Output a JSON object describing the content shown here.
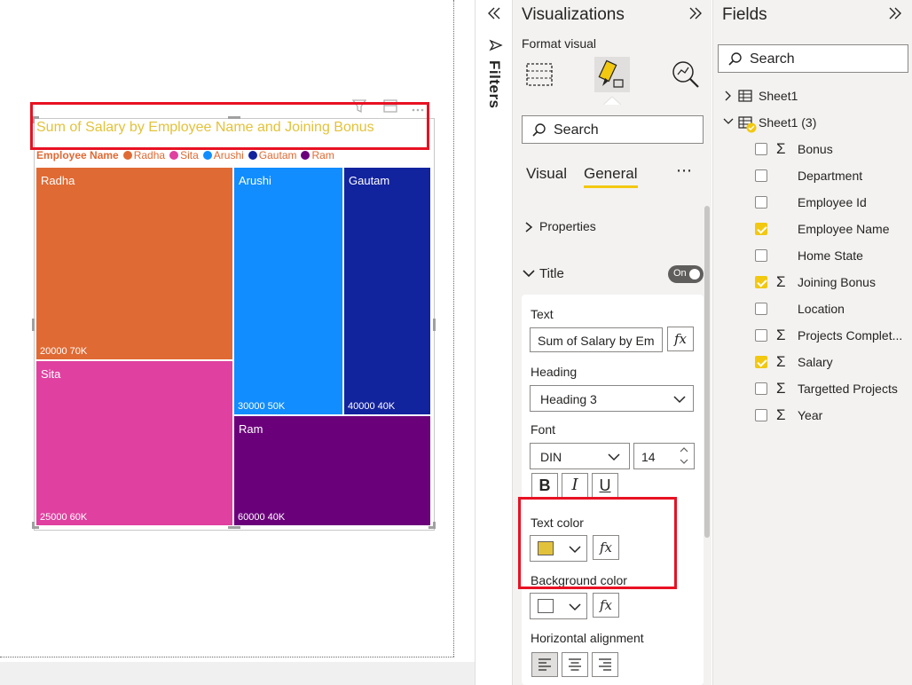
{
  "canvas": {
    "chart": {
      "title": "Sum of Salary by Employee Name and Joining Bonus",
      "legend_title": "Employee Name",
      "legend": [
        {
          "name": "Radha",
          "color": "#e06a34"
        },
        {
          "name": "Sita",
          "color": "#e040a0"
        },
        {
          "name": "Arushi",
          "color": "#118dff"
        },
        {
          "name": "Gautam",
          "color": "#12239e"
        },
        {
          "name": "Ram",
          "color": "#6b007b"
        }
      ],
      "tiles": [
        {
          "name": "Radha",
          "value_label": "20000 70K"
        },
        {
          "name": "Sita",
          "value_label": "25000 60K"
        },
        {
          "name": "Arushi",
          "value_label": "30000 50K"
        },
        {
          "name": "Gautam",
          "value_label": "40000 40K"
        },
        {
          "name": "Ram",
          "value_label": "60000 40K"
        }
      ]
    }
  },
  "chart_data": {
    "type": "treemap",
    "title": "Sum of Salary by Employee Name and Joining Bonus",
    "legend_title": "Employee Name",
    "series": [
      {
        "name": "Radha",
        "joining_bonus": 20000,
        "salary": 70000,
        "label": "20000 70K"
      },
      {
        "name": "Sita",
        "joining_bonus": 25000,
        "salary": 60000,
        "label": "25000 60K"
      },
      {
        "name": "Arushi",
        "joining_bonus": 30000,
        "salary": 50000,
        "label": "30000 50K"
      },
      {
        "name": "Gautam",
        "joining_bonus": 40000,
        "salary": 40000,
        "label": "40000 40K"
      },
      {
        "name": "Ram",
        "joining_bonus": 60000,
        "salary": 40000,
        "label": "60000 40K"
      }
    ]
  },
  "filters": {
    "label": "Filters"
  },
  "viz_pane": {
    "title": "Visualizations",
    "subtitle": "Format visual",
    "search_placeholder": "Search",
    "tabs": [
      "Visual",
      "General"
    ],
    "more": "⋯",
    "properties_label": "Properties",
    "title_section": {
      "label": "Title",
      "toggle": "On",
      "text_label": "Text",
      "text_value": "Sum of Salary by Em",
      "heading_label": "Heading",
      "heading_value": "Heading 3",
      "font_label": "Font",
      "font_value": "DIN",
      "font_size": "14",
      "bold": "B",
      "italic": "I",
      "underline": "U",
      "text_color_label": "Text color",
      "text_color": "#e3c23b",
      "background_color_label": "Background color",
      "background_color": "#ffffff",
      "h_align_label": "Horizontal alignment",
      "fx": "fx"
    }
  },
  "fields_pane": {
    "title": "Fields",
    "search_placeholder": "Search",
    "tables": [
      {
        "name": "Sheet1",
        "expanded": false
      },
      {
        "name": "Sheet1 (3)",
        "expanded": true
      }
    ],
    "fields": [
      {
        "name": "Bonus",
        "sigma": true,
        "checked": false
      },
      {
        "name": "Department",
        "sigma": false,
        "checked": false
      },
      {
        "name": "Employee Id",
        "sigma": false,
        "checked": false
      },
      {
        "name": "Employee Name",
        "sigma": false,
        "checked": true
      },
      {
        "name": "Home State",
        "sigma": false,
        "checked": false
      },
      {
        "name": "Joining Bonus",
        "sigma": true,
        "checked": true
      },
      {
        "name": "Location",
        "sigma": false,
        "checked": false
      },
      {
        "name": "Projects Complet...",
        "sigma": true,
        "checked": false
      },
      {
        "name": "Salary",
        "sigma": true,
        "checked": true
      },
      {
        "name": "Targetted Projects",
        "sigma": true,
        "checked": false
      },
      {
        "name": "Year",
        "sigma": true,
        "checked": false
      }
    ]
  }
}
